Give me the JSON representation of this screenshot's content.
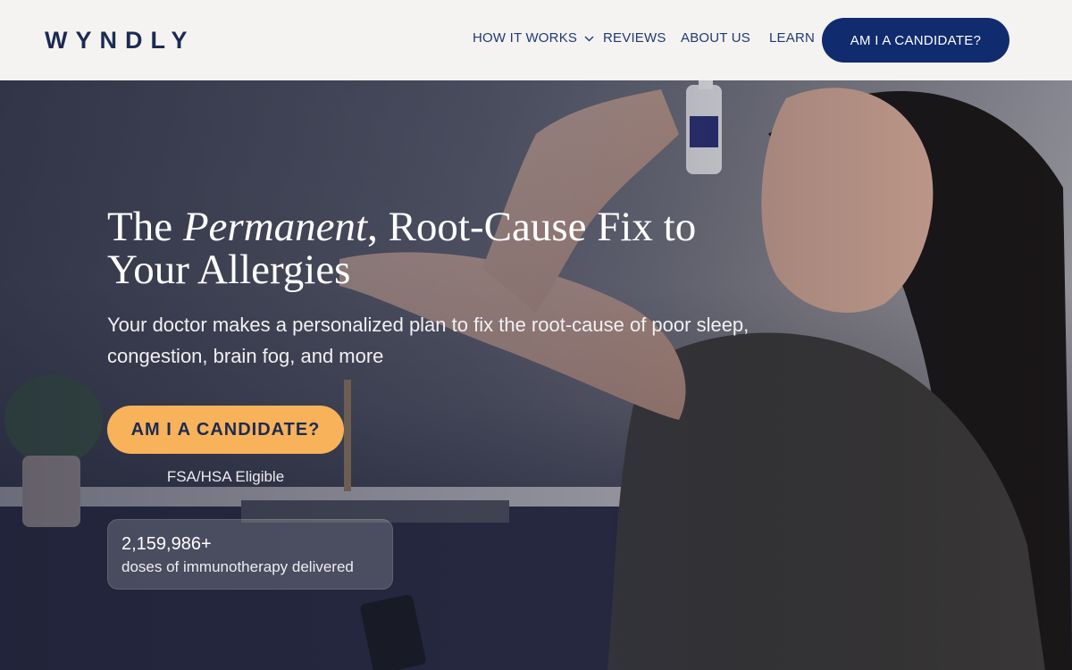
{
  "brand": {
    "logo_text": "WYNDLY"
  },
  "nav": {
    "items": [
      {
        "label": "HOW IT WORKS",
        "has_dropdown": true
      },
      {
        "label": "REVIEWS"
      },
      {
        "label": "ABOUT US"
      },
      {
        "label": "LEARN"
      }
    ],
    "cta_label": "AM I A CANDIDATE?"
  },
  "hero": {
    "headline_pre": "The ",
    "headline_em": "Permanent",
    "headline_post": ", Root-Cause Fix to Your Allergies",
    "subtitle": "Your doctor makes a personalized plan to fix the root-cause of poor sleep, congestion, brain fog, and more",
    "cta_label": "AM I A CANDIDATE?",
    "eligibility": "FSA/HSA Eligible",
    "stat": {
      "value": "2,159,986+",
      "label": "doses of immunotherapy delivered"
    }
  },
  "colors": {
    "brand_navy": "#1c2b52",
    "nav_cta_bg": "#102c6e",
    "hero_cta_bg": "#f7b25a",
    "header_bg": "#f4f3f1"
  },
  "icons": {
    "dropdown": "chevron-down-icon"
  }
}
